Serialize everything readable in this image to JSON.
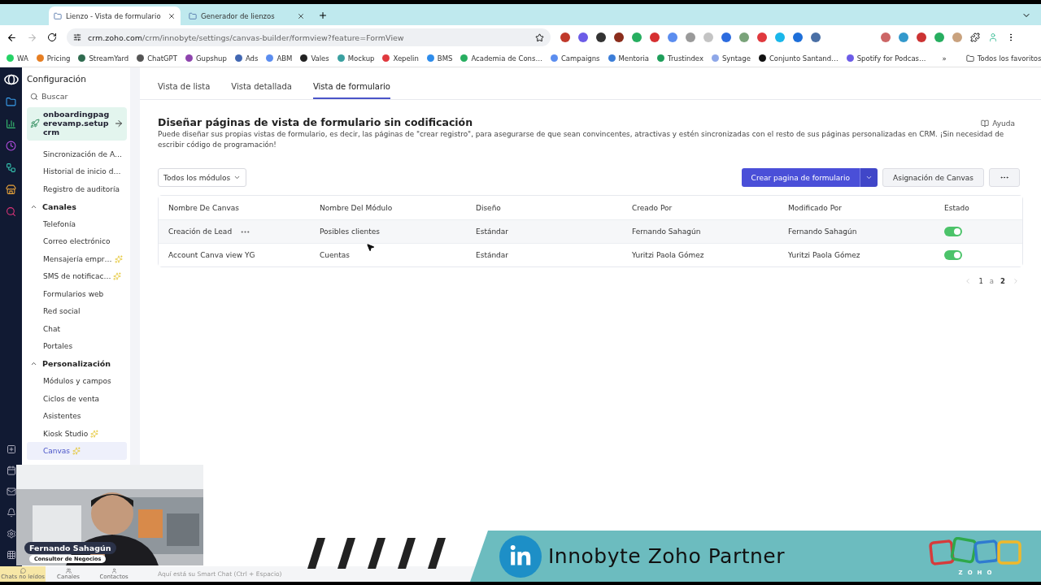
{
  "browser": {
    "tabs": [
      {
        "title": "Lienzo - Vista de formulario",
        "selected": true
      },
      {
        "title": "Generador de lienzos",
        "selected": false
      }
    ],
    "url_host": "crm.zoho.com",
    "url_path": "/crm/innobyte/settings/canvas-builder/formview?feature=FormView",
    "extensions": [
      {
        "color": "#c0392b"
      },
      {
        "color": "#6c5ce7"
      },
      {
        "color": "#333333"
      },
      {
        "color": "#8b2d1c"
      },
      {
        "color": "#27ae60"
      },
      {
        "color": "#d63031"
      },
      {
        "color": "#5b8def"
      },
      {
        "color": "#9a9a9a"
      },
      {
        "color": "#c4c4c4"
      },
      {
        "color": "#2d6cdf"
      },
      {
        "color": "#7aa37a"
      },
      {
        "color": "#e0393e"
      },
      {
        "color": "#1ab7ea"
      },
      {
        "color": "#1e6fd9"
      },
      {
        "color": "#4a6fa5"
      }
    ],
    "extensions_right": [
      {
        "color": "#cc6666"
      },
      {
        "color": "#3399cc"
      },
      {
        "color": "#cc3333"
      },
      {
        "color": "#27ae60"
      },
      {
        "color": "#c9a27e"
      }
    ],
    "bookmarks": [
      {
        "label": "WA",
        "color": "#25d366"
      },
      {
        "label": "Pricing",
        "color": "#e67e22"
      },
      {
        "label": "StreamYard",
        "color": "#2f6b4f"
      },
      {
        "label": "ChatGPT",
        "color": "#555555"
      },
      {
        "label": "Gupshup",
        "color": "#8e44ad"
      },
      {
        "label": "Ads",
        "color": "#4267b2"
      },
      {
        "label": "ABM",
        "color": "#5b8def"
      },
      {
        "label": "Vales",
        "color": "#222222"
      },
      {
        "label": "Mockup",
        "color": "#3aa0a0"
      },
      {
        "label": "Xepelin",
        "color": "#e0393e"
      },
      {
        "label": "BMS",
        "color": "#2d8ceb"
      },
      {
        "label": "Academia de Cons…",
        "color": "#27ae60"
      },
      {
        "label": "Campaigns",
        "color": "#5b8def"
      },
      {
        "label": "Mentoria",
        "color": "#3b7dd8"
      },
      {
        "label": "Trustindex",
        "color": "#1e9e5a"
      },
      {
        "label": "Syntage",
        "color": "#8ea7e8"
      },
      {
        "label": "Conjunto Santand…",
        "color": "#111111"
      },
      {
        "label": "Spotify for Podcas…",
        "color": "#6c5ce7"
      }
    ],
    "bookmarks_more": "»",
    "all_bookmarks": "Todos los favoritos"
  },
  "sidebar": {
    "title": "Configuración",
    "search_placeholder": "Buscar",
    "onboarding": "onboardingpagerevamp.setupcrm",
    "items": [
      {
        "kind": "link",
        "label": "Sincronización de A…",
        "new": false,
        "selected": false
      },
      {
        "kind": "link",
        "label": "Historial de inicio d…",
        "new": false,
        "selected": false
      },
      {
        "kind": "link",
        "label": "Registro de auditoría",
        "new": false,
        "selected": false
      },
      {
        "kind": "section",
        "label": "Canales",
        "expanded": true,
        "children": [
          {
            "label": "Telefonía",
            "new": false,
            "selected": false
          },
          {
            "label": "Correo electrónico",
            "new": false,
            "selected": false
          },
          {
            "label": "Mensajería empr…",
            "new": true,
            "selected": false
          },
          {
            "label": "SMS de notificac…",
            "new": true,
            "selected": false
          },
          {
            "label": "Formularios web",
            "new": false,
            "selected": false
          },
          {
            "label": "Red social",
            "new": false,
            "selected": false
          },
          {
            "label": "Chat",
            "new": false,
            "selected": false
          },
          {
            "label": "Portales",
            "new": false,
            "selected": false
          }
        ]
      },
      {
        "kind": "section",
        "label": "Personalización",
        "expanded": true,
        "children": [
          {
            "label": "Módulos y campos",
            "new": false,
            "selected": false
          },
          {
            "label": "Ciclos de venta",
            "new": false,
            "selected": false
          },
          {
            "label": "Asistentes",
            "new": false,
            "selected": false
          },
          {
            "label": "Kiosk Studio",
            "new": true,
            "selected": false
          },
          {
            "label": "Canvas",
            "new": true,
            "selected": true
          }
        ]
      }
    ]
  },
  "content": {
    "tabs": [
      {
        "label": "Vista de lista",
        "selected": false
      },
      {
        "label": "Vista detallada",
        "selected": false
      },
      {
        "label": "Vista de formulario",
        "selected": true
      }
    ],
    "heading": "Diseñar páginas de vista de formulario sin codificación",
    "description": "Puede diseñar sus propias vistas de formulario, es decir, las páginas de \"crear registro\", para asegurarse de que sean convincentes, atractivas y estén sincronizadas con el resto de sus páginas personalizadas en CRM. ¡Sin necesidad de escribir código de programación!",
    "help": "Ayuda",
    "module_filter": "Todos los módulos",
    "create_button": "Crear pagina de formulario",
    "assign_button": "Asignación de Canvas",
    "table": {
      "columns": [
        "Nombre De Canvas",
        "Nombre Del Módulo",
        "Diseño",
        "Creado Por",
        "Modificado Por",
        "Estado"
      ],
      "rows": [
        {
          "cells": [
            "Creación de Lead",
            "Posibles clientes",
            "Estándar",
            "Fernando Sahagún",
            "Fernando Sahagún"
          ],
          "highlighted": true,
          "on": true
        },
        {
          "cells": [
            "Account Canva view YG",
            "Cuentas",
            "Estándar",
            "Yuritzi Paola Gómez",
            "Yuritzi Paola Gómez"
          ],
          "highlighted": false,
          "on": true
        }
      ]
    },
    "pagination": {
      "from": "1",
      "separator": "a",
      "to": "2"
    }
  },
  "status_bar": {
    "items": [
      {
        "label": "Chats no leídos",
        "selected": true
      },
      {
        "label": "Canales",
        "selected": false
      },
      {
        "label": "Contactos",
        "selected": false
      }
    ],
    "smart_chat_placeholder": "Aquí está su Smart Chat (Ctrl + Espacio)"
  },
  "video_overlay": {
    "name": "Fernando Sahagún",
    "role": "Consultor de Negocios"
  },
  "banner": {
    "text": "Innobyte Zoho Partner",
    "logo_text": "ZOHO"
  }
}
